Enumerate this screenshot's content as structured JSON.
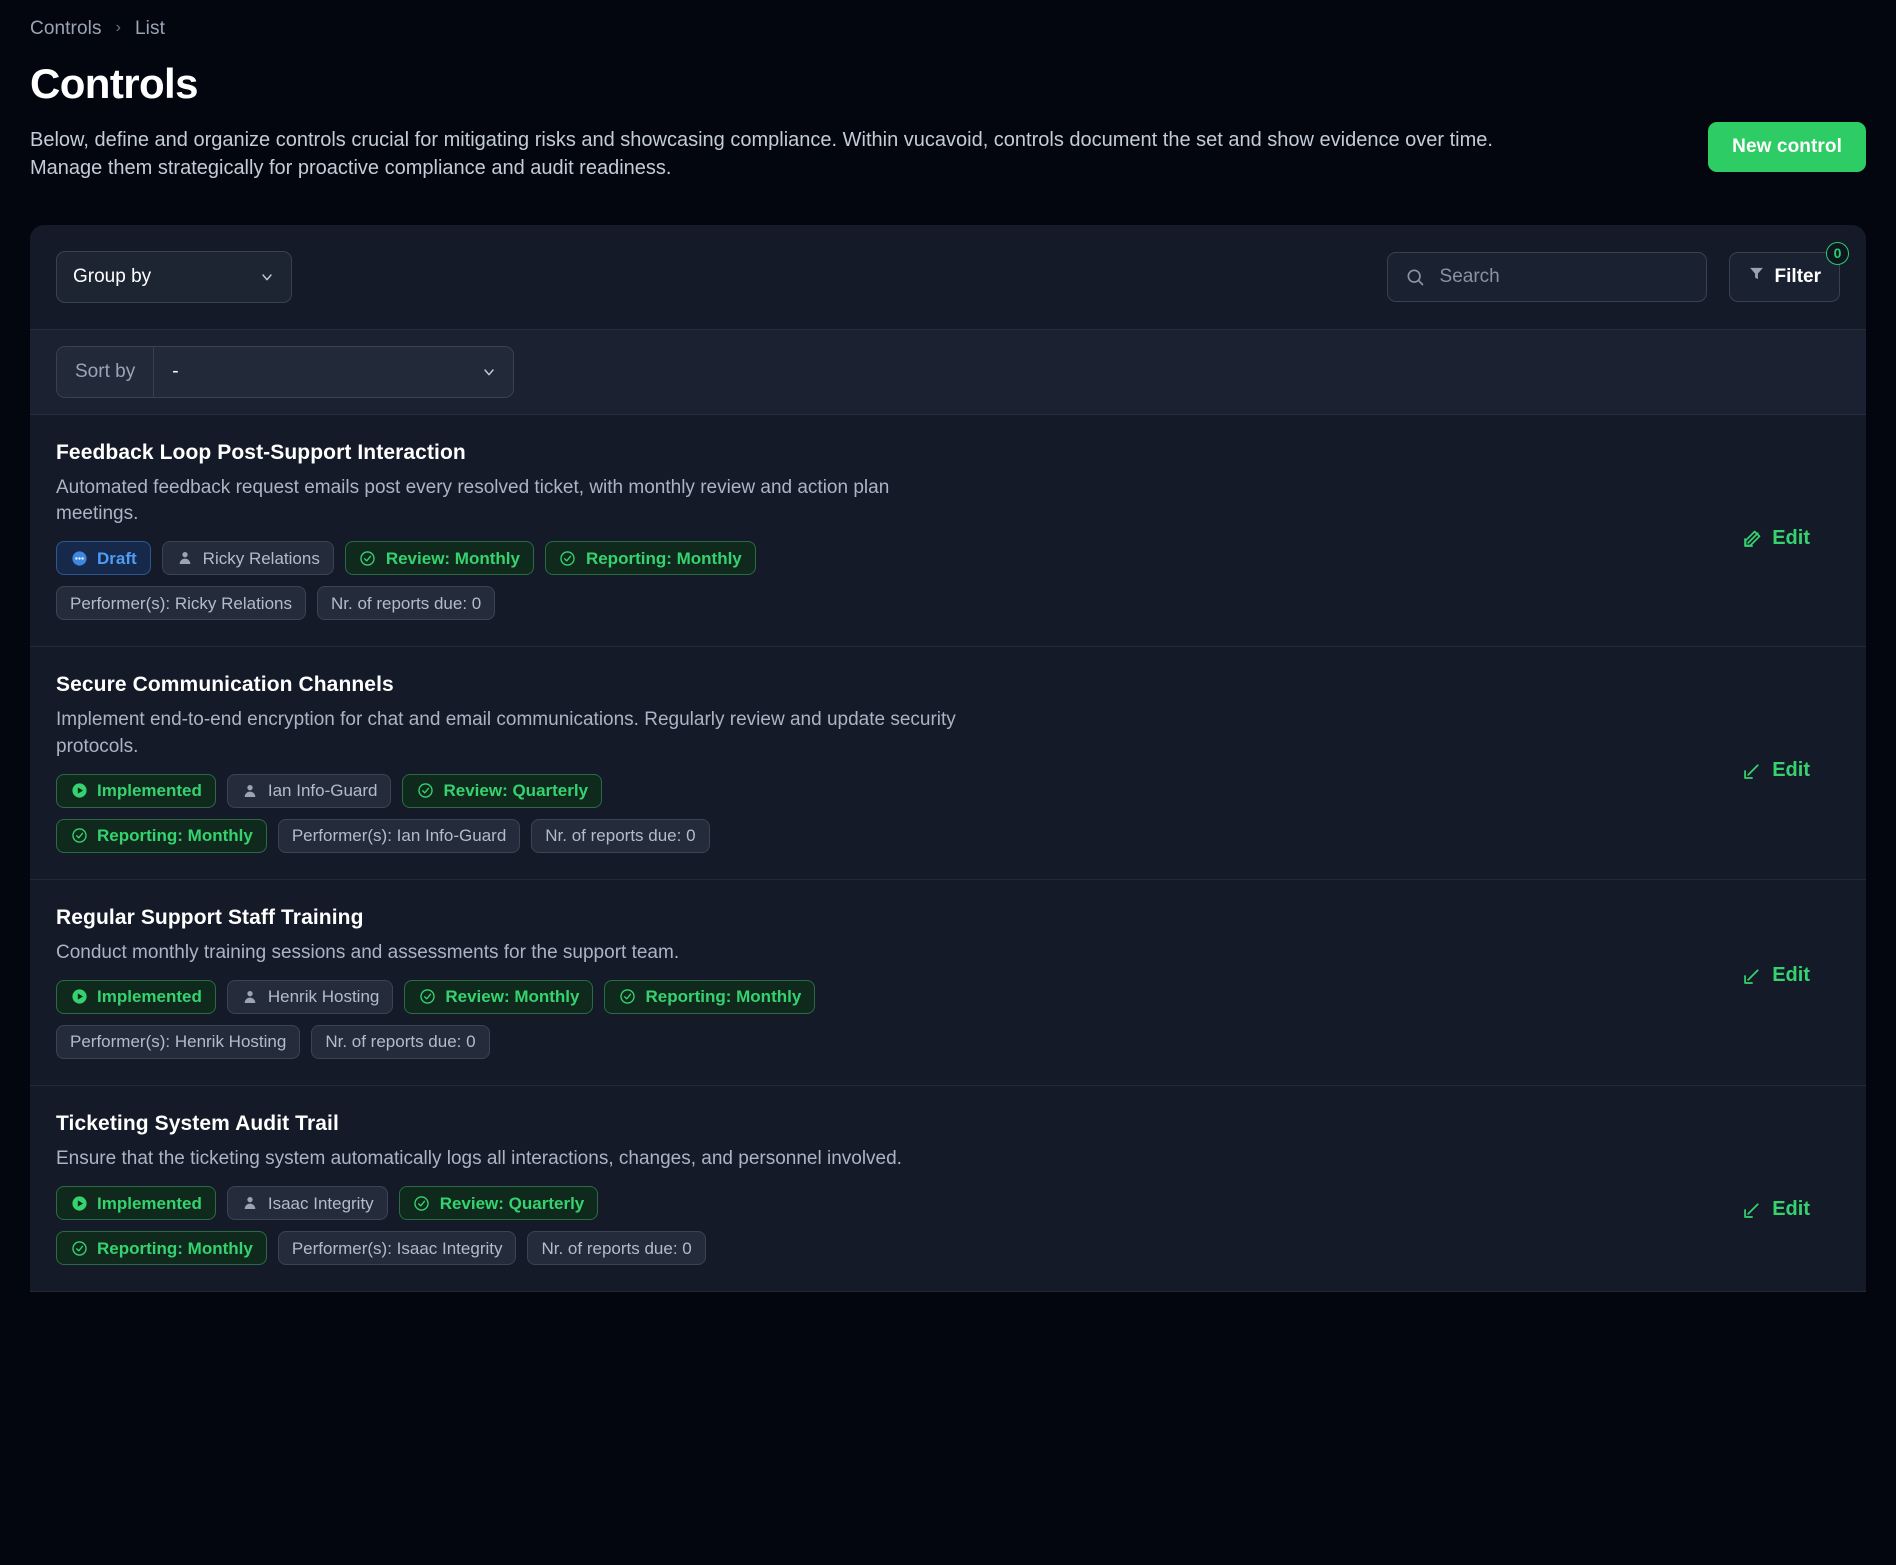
{
  "breadcrumb": {
    "root": "Controls",
    "separator": "›",
    "current": "List"
  },
  "header": {
    "title": "Controls",
    "description": "Below, define and organize controls crucial for mitigating risks and showcasing compliance. Within vucavoid, controls document the set and show evidence over time. Manage them strategically for proactive compliance and audit readiness.",
    "new_control_label": "New control"
  },
  "toolbar": {
    "group_by_label": "Group by",
    "search_placeholder": "Search",
    "search_value": "",
    "filter_label": "Filter",
    "filter_count": "0",
    "sort_by_label": "Sort by",
    "sort_by_value": "-"
  },
  "colors": {
    "accent_green": "#2ecc64",
    "badge_green": "#35d26f",
    "badge_blue": "#4d9cf5",
    "page_bg": "#03060f",
    "card_bg": "#141a28"
  },
  "rows": [
    {
      "title": "Feedback Loop Post-Support Interaction",
      "description": "Automated feedback request emails post every resolved ticket, with monthly review and action plan meetings.",
      "status": "Draft",
      "status_icon": "dots-circle-icon",
      "owner": "Ricky Relations",
      "review": "Review: Monthly",
      "reporting": "Reporting: Monthly",
      "performers": "Performer(s): Ricky Relations",
      "reports_due": "Nr. of reports due: 0",
      "edit_label": "Edit"
    },
    {
      "title": "Secure Communication Channels",
      "description": "Implement end-to-end encryption for chat and email communications. Regularly review and update security protocols.",
      "status": "Implemented",
      "status_icon": "play-circle-icon",
      "owner": "Ian Info-Guard",
      "review": "Review: Quarterly",
      "reporting": "Reporting: Monthly",
      "performers": "Performer(s): Ian Info-Guard",
      "reports_due": "Nr. of reports due: 0",
      "edit_label": "Edit"
    },
    {
      "title": "Regular Support Staff Training",
      "description": "Conduct monthly training sessions and assessments for the support team.",
      "status": "Implemented",
      "status_icon": "play-circle-icon",
      "owner": "Henrik Hosting",
      "review": "Review: Monthly",
      "reporting": "Reporting: Monthly",
      "performers": "Performer(s): Henrik Hosting",
      "reports_due": "Nr. of reports due: 0",
      "edit_label": "Edit"
    },
    {
      "title": "Ticketing System Audit Trail",
      "description": "Ensure that the ticketing system automatically logs all interactions, changes, and personnel involved.",
      "status": "Implemented",
      "status_icon": "play-circle-icon",
      "owner": "Isaac Integrity",
      "review": "Review: Quarterly",
      "reporting": "Reporting: Monthly",
      "performers": "Performer(s): Isaac Integrity",
      "reports_due": "Nr. of reports due: 0",
      "edit_label": "Edit"
    }
  ]
}
